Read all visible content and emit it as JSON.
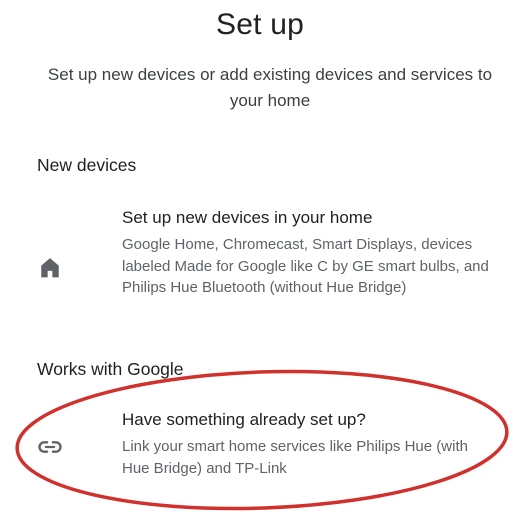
{
  "header": {
    "title": "Set up",
    "subtitle": "Set up new devices or add existing devices and services to your home"
  },
  "sections": {
    "new_devices": {
      "heading": "New devices",
      "item": {
        "icon": "home-icon",
        "title": "Set up new devices in your home",
        "description": "Google Home, Chromecast, Smart Displays, devices labeled Made for Google like C by GE smart bulbs, and Philips Hue Bluetooth (without Hue Bridge)"
      }
    },
    "works_with_google": {
      "heading": "Works with Google",
      "item": {
        "icon": "link-icon",
        "title": "Have something already set up?",
        "description": "Link your smart home services like Philips Hue (with Hue Bridge) and TP-Link"
      }
    }
  },
  "colors": {
    "annotation": "#d0312d",
    "icon": "#5f6368"
  }
}
